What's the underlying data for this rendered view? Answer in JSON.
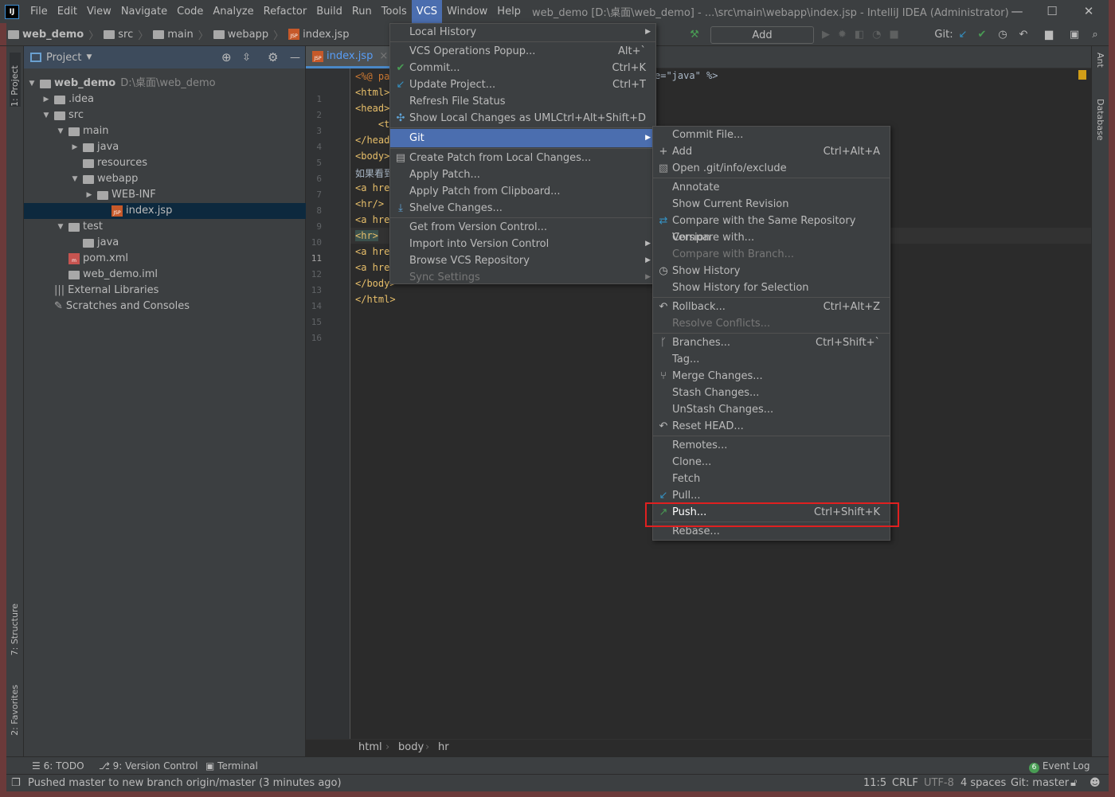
{
  "app": {
    "logo": "IJ",
    "title": "web_demo [D:\\桌面\\web_demo] - ...\\src\\main\\webapp\\index.jsp - IntelliJ IDEA (Administrator)"
  },
  "menubar": [
    "File",
    "Edit",
    "View",
    "Navigate",
    "Code",
    "Analyze",
    "Refactor",
    "Build",
    "Run",
    "Tools",
    "VCS",
    "Window",
    "Help"
  ],
  "breadcrumb": [
    "web_demo",
    "src",
    "main",
    "webapp",
    "index.jsp"
  ],
  "toolbar": {
    "add_config": "Add Configuration...",
    "git_label": "Git:"
  },
  "project": {
    "title": "Project",
    "tree": [
      {
        "label": "web_demo",
        "extra": "D:\\桌面\\web_demo",
        "depth": 0,
        "arrow": "▼",
        "icon": "module-folder"
      },
      {
        "label": ".idea",
        "depth": 1,
        "arrow": "▶",
        "icon": "folder"
      },
      {
        "label": "src",
        "depth": 1,
        "arrow": "▼",
        "icon": "folder"
      },
      {
        "label": "main",
        "depth": 2,
        "arrow": "▼",
        "icon": "folder"
      },
      {
        "label": "java",
        "depth": 3,
        "arrow": "▶",
        "icon": "folder"
      },
      {
        "label": "resources",
        "depth": 3,
        "arrow": "",
        "icon": "folder"
      },
      {
        "label": "webapp",
        "depth": 3,
        "arrow": "▼",
        "icon": "folder"
      },
      {
        "label": "WEB-INF",
        "depth": 4,
        "arrow": "▶",
        "icon": "folder"
      },
      {
        "label": "index.jsp",
        "depth": 5,
        "arrow": "",
        "icon": "jsp",
        "selected": true
      },
      {
        "label": "test",
        "depth": 2,
        "arrow": "▼",
        "icon": "folder"
      },
      {
        "label": "java",
        "depth": 3,
        "arrow": "",
        "icon": "folder"
      },
      {
        "label": "pom.xml",
        "depth": 2,
        "arrow": "",
        "icon": "maven"
      },
      {
        "label": "web_demo.iml",
        "depth": 2,
        "arrow": "",
        "icon": "file"
      },
      {
        "label": "External Libraries",
        "depth": 1,
        "arrow": "",
        "icon": "library"
      },
      {
        "label": "Scratches and Consoles",
        "depth": 1,
        "arrow": "",
        "icon": "scratch"
      }
    ]
  },
  "side_tabs": {
    "project": "1: Project",
    "structure": "7: Structure",
    "favorites": "2: Favorites",
    "ant": "Ant",
    "database": "Database"
  },
  "editor": {
    "tab": "index.jsp",
    "lines": [
      "<%@ pa",
      "<html>",
      "<head>",
      "    <t",
      "</head",
      "<body>",
      "如果看到",
      "<a hre",
      "<hr/>",
      "<a hre",
      "<hr>",
      "<a hre",
      "<a hre",
      "</body>",
      "</html>",
      ""
    ],
    "line1_tail": "e=\"java\" %>",
    "current_line": 11,
    "crumbs": [
      "html",
      "body",
      "hr"
    ]
  },
  "vcs_menu": [
    {
      "label": "Local History",
      "sub": true
    },
    {
      "sep": true
    },
    {
      "label": "VCS Operations Popup...",
      "shortcut": "Alt+`"
    },
    {
      "label": "Commit...",
      "shortcut": "Ctrl+K",
      "icon": "✔",
      "iconColor": "#499c54"
    },
    {
      "label": "Update Project...",
      "shortcut": "Ctrl+T",
      "icon": "↙",
      "iconColor": "#3592c4"
    },
    {
      "label": "Refresh File Status"
    },
    {
      "label": "Show Local Changes as UML",
      "shortcut": "Ctrl+Alt+Shift+D",
      "icon": "✣",
      "iconColor": "#5fa4d8"
    },
    {
      "sep": true
    },
    {
      "label": "Git",
      "sub": true,
      "highlight": true
    },
    {
      "sep": true
    },
    {
      "label": "Create Patch from Local Changes...",
      "icon": "▤",
      "iconColor": "#aaa"
    },
    {
      "label": "Apply Patch..."
    },
    {
      "label": "Apply Patch from Clipboard..."
    },
    {
      "label": "Shelve Changes...",
      "icon": "⤓",
      "iconColor": "#5fa4d8"
    },
    {
      "sep": true
    },
    {
      "label": "Get from Version Control..."
    },
    {
      "label": "Import into Version Control",
      "sub": true
    },
    {
      "label": "Browse VCS Repository",
      "sub": true
    },
    {
      "label": "Sync Settings",
      "sub": true,
      "disabled": true
    }
  ],
  "git_menu": [
    {
      "label": "Commit File..."
    },
    {
      "label": "Add",
      "shortcut": "Ctrl+Alt+A",
      "icon": "+",
      "iconColor": "#bbb"
    },
    {
      "label": "Open .git/info/exclude",
      "icon": "▧",
      "iconColor": "#999"
    },
    {
      "sep": true
    },
    {
      "label": "Annotate"
    },
    {
      "label": "Show Current Revision"
    },
    {
      "label": "Compare with the Same Repository Version",
      "icon": "⇄",
      "iconColor": "#3592c4"
    },
    {
      "label": "Compare with..."
    },
    {
      "label": "Compare with Branch...",
      "disabled": true
    },
    {
      "label": "Show History",
      "icon": "◷",
      "iconColor": "#bbb"
    },
    {
      "label": "Show History for Selection"
    },
    {
      "sep": true
    },
    {
      "label": "Rollback...",
      "shortcut": "Ctrl+Alt+Z",
      "icon": "↶",
      "iconColor": "#bbb"
    },
    {
      "label": "Resolve Conflicts...",
      "disabled": true
    },
    {
      "sep": true
    },
    {
      "label": "Branches...",
      "shortcut": "Ctrl+Shift+`",
      "icon": "ᚴ",
      "iconColor": "#bbb"
    },
    {
      "label": "Tag..."
    },
    {
      "label": "Merge Changes...",
      "icon": "⑂",
      "iconColor": "#bbb"
    },
    {
      "label": "Stash Changes..."
    },
    {
      "label": "UnStash Changes..."
    },
    {
      "label": "Reset HEAD...",
      "icon": "↶",
      "iconColor": "#bbb"
    },
    {
      "sep": true
    },
    {
      "label": "Remotes..."
    },
    {
      "label": "Clone..."
    },
    {
      "label": "Fetch"
    },
    {
      "label": "Pull...",
      "icon": "↙",
      "iconColor": "#3592c4"
    },
    {
      "label": "Push...",
      "shortcut": "Ctrl+Shift+K",
      "icon": "↗",
      "iconColor": "#499c54"
    },
    {
      "sep": true
    },
    {
      "label": "Rebase..."
    }
  ],
  "toolwindows": {
    "todo": "6: TODO",
    "vc": "9: Version Control",
    "terminal": "Terminal",
    "event_log": "Event Log",
    "event_count": "6"
  },
  "status": {
    "message": "Pushed master to new branch origin/master (3 minutes ago)",
    "position": "11:5",
    "line_sep": "CRLF",
    "encoding": "UTF-8",
    "indent": "4 spaces",
    "branch": "Git: master"
  },
  "colors": {
    "accent": "#4b6eaf",
    "highlight_box": "#e02020"
  }
}
